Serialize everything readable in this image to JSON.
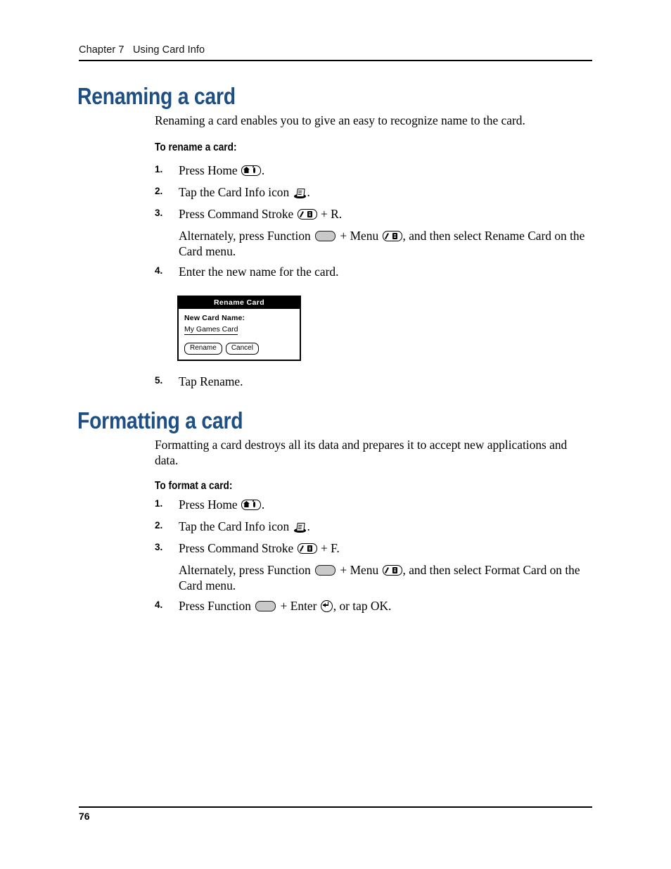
{
  "header": {
    "chapter": "Chapter 7   Using Card Info"
  },
  "sections": [
    {
      "heading": "Renaming a card",
      "intro": "Renaming a card enables you to give an easy to recognize name to the card.",
      "subheading": "To rename a card:",
      "steps": [
        {
          "num": "1.",
          "text_before": "Press Home ",
          "icon": "home-key-icon",
          "text_after": "."
        },
        {
          "num": "2.",
          "text_before": "Tap the Card Info icon ",
          "icon": "card-info-icon",
          "text_after": "."
        },
        {
          "num": "3.",
          "text_before": "Press Command Stroke ",
          "icon": "command-stroke-key-icon",
          "text_after": " + R."
        }
      ],
      "continuation": {
        "part1": "Alternately, press Function ",
        "icon1": "function-key-icon",
        "part2": " + Menu ",
        "icon2": "menu-key-icon",
        "part3": ", and then select Rename Card on the Card menu."
      },
      "step4": {
        "num": "4.",
        "text": "Enter the new name for the card."
      },
      "step5": {
        "num": "5.",
        "text": "Tap Rename."
      }
    },
    {
      "heading": "Formatting a card",
      "intro": "Formatting a card destroys all its data and prepares it to accept new applications and data.",
      "subheading": "To format a card:",
      "steps": [
        {
          "num": "1.",
          "text_before": "Press Home ",
          "icon": "home-key-icon",
          "text_after": "."
        },
        {
          "num": "2.",
          "text_before": "Tap the Card Info icon ",
          "icon": "card-info-icon",
          "text_after": "."
        },
        {
          "num": "3.",
          "text_before": "Press Command Stroke ",
          "icon": "command-stroke-key-icon",
          "text_after": " + F."
        }
      ],
      "continuation": {
        "part1": "Alternately, press Function ",
        "icon1": "function-key-icon",
        "part2": " + Menu ",
        "icon2": "menu-key-icon",
        "part3": ", and then select Format Card on the Card menu."
      },
      "step4": {
        "num": "4.",
        "part1": "Press Function ",
        "icon1": "function-key-icon",
        "part2": " + Enter ",
        "icon2": "enter-key-icon",
        "part3": ", or tap OK."
      }
    }
  ],
  "dialog": {
    "title": "Rename Card",
    "label": "New Card Name:",
    "value": "My Games Card",
    "confirm_label": "Rename",
    "cancel_label": "Cancel"
  },
  "footer": {
    "page_number": "76"
  },
  "colors": {
    "heading": "#1d4e84",
    "text": "#000000",
    "function_key_fill": "#c9c9c9"
  }
}
